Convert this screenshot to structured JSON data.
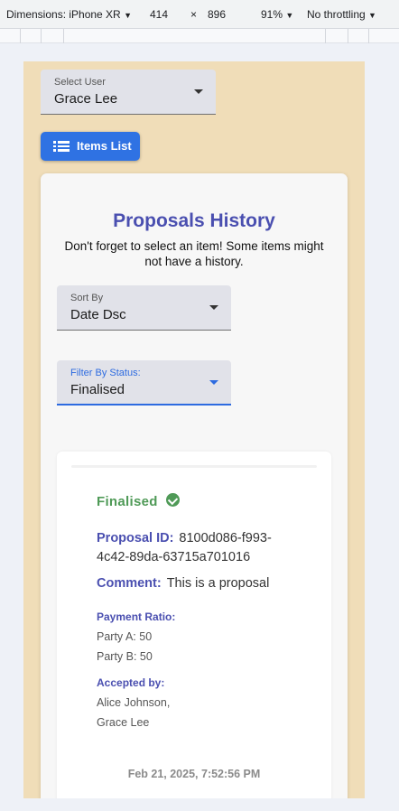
{
  "devtools": {
    "device_label": "Dimensions: iPhone XR",
    "width": "414",
    "times": "×",
    "height": "896",
    "zoom": "91%",
    "throttling": "No throttling"
  },
  "select_user": {
    "label": "Select User",
    "value": "Grace Lee"
  },
  "items_button": {
    "label": "Items List"
  },
  "history": {
    "title": "Proposals History",
    "subtitle": "Don't forget to select an item! Some items might not have a history."
  },
  "sort": {
    "label": "Sort By",
    "value": "Date Dsc"
  },
  "filter": {
    "label": "Filter By Status:",
    "value": "Finalised"
  },
  "proposal": {
    "status": "Finalised",
    "id_label": "Proposal ID:",
    "id_value": "8100d086-f993-4c42-89da-63715a701016",
    "comment_label": "Comment:",
    "comment_value": "This is a proposal",
    "ratio_label": "Payment Ratio:",
    "party_a": "Party A: 50",
    "party_b": "Party B: 50",
    "accepted_label": "Accepted by:",
    "accepted_1": "Alice Johnson,",
    "accepted_2": "Grace Lee",
    "date": "Feb 21, 2025, 7:52:56 PM"
  },
  "colors": {
    "accent": "#4a4fb0",
    "button": "#2f72e3",
    "success": "#4f9a57",
    "page_bg": "#f0ddb8"
  }
}
